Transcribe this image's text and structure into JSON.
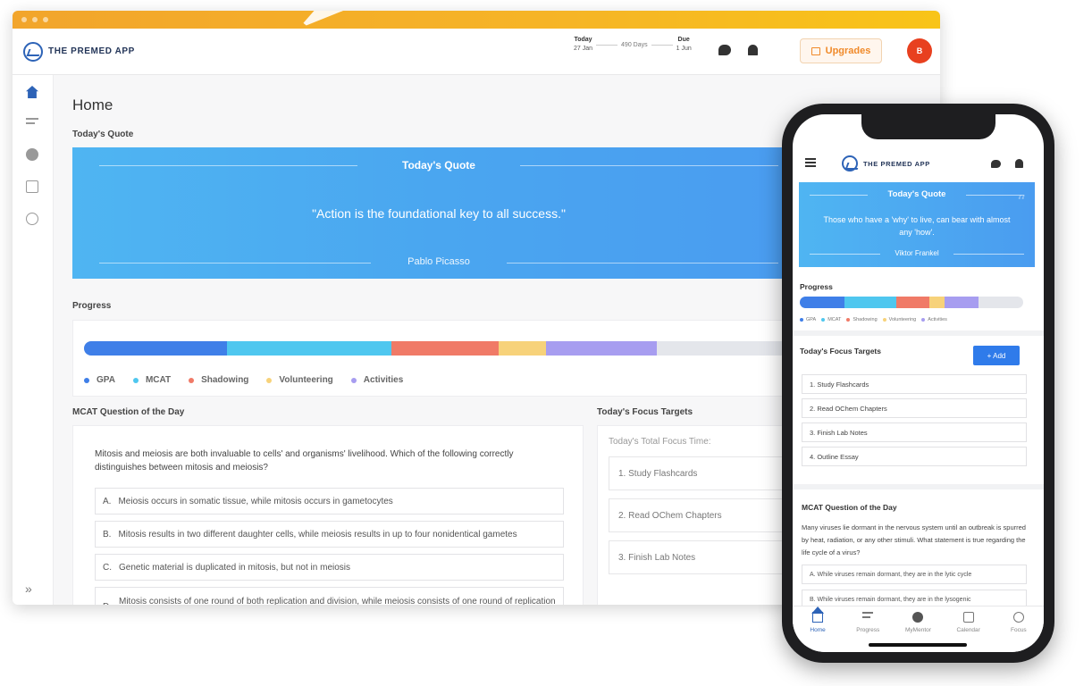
{
  "colors": {
    "brand": "#2d63b7",
    "accent_orange": "#f08a2a",
    "quote_blue": "#4aa6f0",
    "gpa": "#3f7fe8",
    "mcat": "#4fc7ef",
    "shadowing": "#f07a67",
    "volunteering": "#f7d27a",
    "activities": "#a79df0"
  },
  "app": {
    "name": "THE PREMED APP"
  },
  "header": {
    "today_label": "Today",
    "today_date": "27 Jan",
    "days_label": "490 Days",
    "due_label": "Due",
    "due_date": "1 Jun",
    "upgrade_label": "Upgrades",
    "avatar_initial": "B"
  },
  "sidebar": {
    "items": [
      {
        "name": "home",
        "icon": "home-icon"
      },
      {
        "name": "progress",
        "icon": "progress-icon"
      },
      {
        "name": "mentor",
        "icon": "mentor-icon"
      },
      {
        "name": "calendar",
        "icon": "calendar-icon"
      },
      {
        "name": "focus",
        "icon": "focus-icon"
      }
    ],
    "expand_icon": "»"
  },
  "page": {
    "title": "Home",
    "quote_section": "Today's Quote",
    "quote_heading": "Today's Quote",
    "quote_text": "\"Action is the foundational key to all success.\"",
    "quote_author": "Pablo Picasso",
    "progress_section": "Progress",
    "mcat_section": "MCAT Question of the Day",
    "focus_section": "Today's Focus Targets",
    "focus_time_label": "Today's Total Focus Time:"
  },
  "progress": {
    "segments": [
      {
        "label": "GPA",
        "color": "#3f7fe8",
        "fraction": 0.2
      },
      {
        "label": "MCAT",
        "color": "#4fc7ef",
        "fraction": 0.23
      },
      {
        "label": "Shadowing",
        "color": "#f07a67",
        "fraction": 0.15
      },
      {
        "label": "Volunteering",
        "color": "#f7d27a",
        "fraction": 0.066
      },
      {
        "label": "Activities",
        "color": "#a79df0",
        "fraction": 0.155
      }
    ]
  },
  "mcat": {
    "question": "Mitosis and meiosis are both invaluable to cells' and organisms' livelihood. Which of the following correctly distinguishes between mitosis and meiosis?",
    "options": [
      {
        "letter": "A.",
        "text": "Meiosis occurs in somatic tissue, while mitosis occurs in gametocytes"
      },
      {
        "letter": "B.",
        "text": "Mitosis results in two different daughter cells, while meiosis results in up to four nonidentical gametes"
      },
      {
        "letter": "C.",
        "text": "Genetic material is duplicated in mitosis, but not in meiosis"
      },
      {
        "letter": "D.",
        "text": "Mitosis consists of one round of both replication and division, while meiosis consists of one round of replication followed by two rounds of division"
      }
    ]
  },
  "focus": {
    "items": [
      "1.  Study Flashcards",
      "2.  Read OChem Chapters",
      "3.  Finish Lab Notes"
    ]
  },
  "phone": {
    "quote_heading": "Today's Quote",
    "quote_text": "Those who have a 'why' to live, can bear with almost any 'how'.",
    "quote_author": "Viktor Frankel",
    "progress_label": "Progress",
    "focus_label": "Today's Focus Targets",
    "add_label": "+  Add",
    "focus_items": [
      "1.  Study Flashcards",
      "2.  Read OChem Chapters",
      "3.  Finish Lab Notes",
      "4.  Outline Essay"
    ],
    "mcat_label": "MCAT Question of the Day",
    "mcat_question": "Many viruses lie dormant in the nervous system until an outbreak is spurred by heat, radiation, or any other stimuli. What statement is true regarding the life cycle of a virus?",
    "mcat_options": [
      "A.  While viruses remain dormant, they are in the lytic cycle",
      "B.  While viruses remain dormant, they are in the lysogenic"
    ],
    "nav": [
      {
        "label": "Home",
        "icon": "home-icon"
      },
      {
        "label": "Progress",
        "icon": "progress-icon"
      },
      {
        "label": "MyMentor",
        "icon": "mentor-icon"
      },
      {
        "label": "Calendar",
        "icon": "calendar-icon"
      },
      {
        "label": "Focus",
        "icon": "focus-icon"
      }
    ]
  }
}
